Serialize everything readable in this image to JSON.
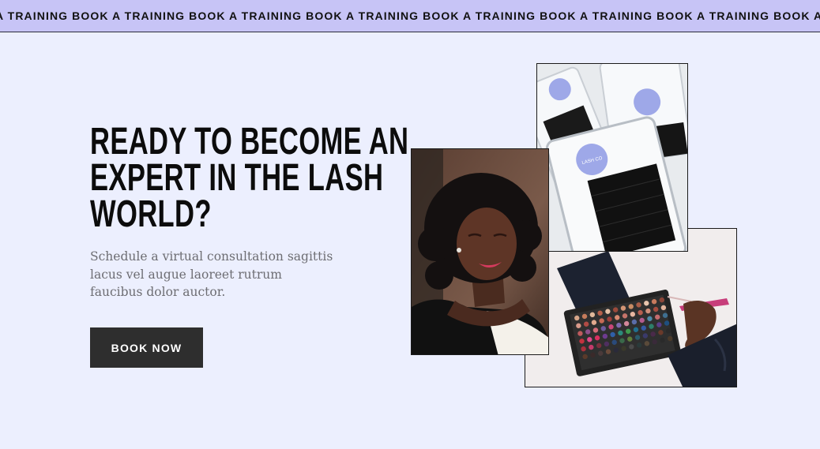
{
  "ticker": {
    "text": "A TRAINING BOOK A TRAINING BOOK A TRAINING BOOK A TRAINING BOOK A TRAINING BOOK A TRAINING BOOK A TRAINING BOOK A TRA"
  },
  "hero": {
    "headline_lines": [
      "READY TO BECOME AN",
      "EXPERT IN THE LASH",
      "WORLD?"
    ],
    "subtext_lines": [
      "Schedule a virtual consultation sagittis",
      "lacus vel augue laoreet rutrum",
      "faucibus dolor auctor."
    ],
    "cta_label": "BOOK NOW"
  },
  "images": {
    "lashes_label": "LASH CO"
  },
  "colors": {
    "background": "#eceffe",
    "ticker_bg": "#c7c4f6",
    "button_bg": "#2e2e2e",
    "lid_accent": "#9ea8e8"
  }
}
